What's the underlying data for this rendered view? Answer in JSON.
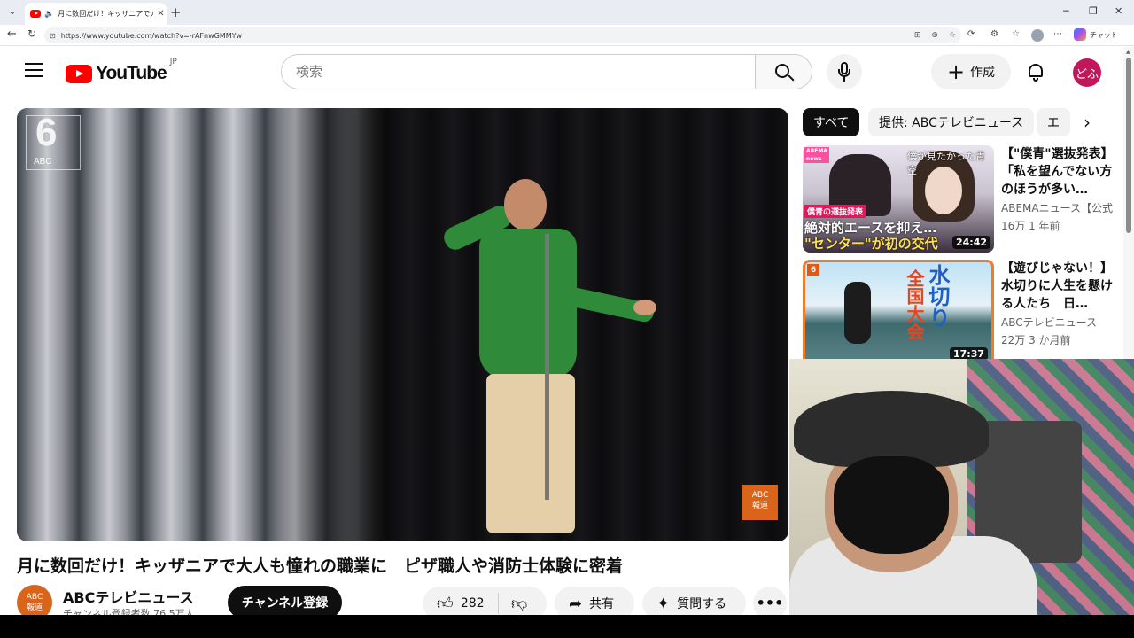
{
  "browser": {
    "tab_title": "月に数回だけ！キッザニアで大人も憧れの職業に…",
    "tab_close": "✕",
    "new_tab": "+",
    "url": "https://www.youtube.com/watch?v=-rAFnwGMMYw",
    "copilot_label": "チャット",
    "win_min": "─",
    "win_max": "❐",
    "win_close": "✕"
  },
  "youtube": {
    "logo_text": "YouTube",
    "country_code": "JP",
    "search_placeholder": "検索",
    "create_label": "作成",
    "avatar_text": "どふ"
  },
  "video": {
    "title": "月に数回だけ！キッザニアで大人も憧れの職業に　ピザ職人や消防士体験に密着",
    "channel_logo_6": "6",
    "channel_logo_abc": "ABC",
    "corner_bug": "ABC\n報道",
    "channel_name": "ABCテレビニュース",
    "channel_avatar": "ABC\n報道",
    "subscribers": "チャンネル登録者数 76.5万人",
    "subscribe_label": "チャンネル登録",
    "like_count": "282",
    "share_label": "共有",
    "ask_label": "質問する",
    "more_label": "•••"
  },
  "sidebar": {
    "chips": [
      "すべて",
      "提供: ABCテレビニュース",
      "エ"
    ],
    "recommendations": [
      {
        "title": "【\"僕青\"選抜発表】「私を望んでない方のほうが多い…",
        "channel": "ABEMAニュース【公式】",
        "meta": "16万  1 年前",
        "duration": "24:42",
        "thumb_tag": "僕青の選抜発表",
        "thumb_line1": "絶対的エースを抑え…",
        "thumb_line2": "\"センター\"が初の交代",
        "thumb_brand": "ABEMA news",
        "thumb_overlay": "僕が見たかった青空"
      },
      {
        "title": "【遊びじゃない！】水切りに人生を懸ける人たち　日…",
        "channel": "ABCテレビニュース",
        "meta": "22万  3 か月前",
        "duration": "17:37",
        "thumb_ch": "6",
        "thumb_text1": "水切り",
        "thumb_text2": "全国大会"
      }
    ]
  },
  "colors": {
    "youtube_red": "#ff0000",
    "subscribe_bg": "#0f0f0f",
    "avatar_bg": "#c2185b",
    "abc_orange": "#d9641a"
  }
}
